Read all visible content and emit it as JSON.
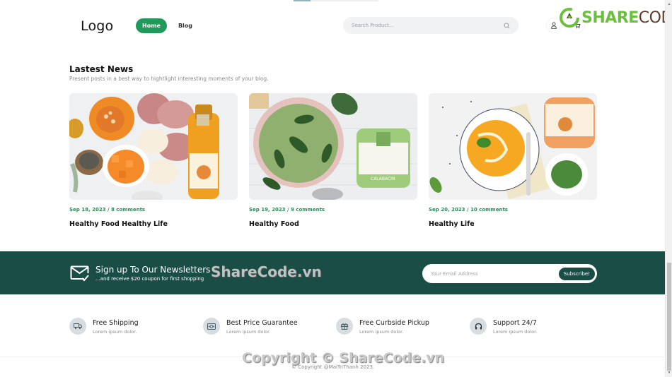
{
  "header": {
    "logo": "Logo",
    "nav": [
      {
        "label": "Home",
        "active": true
      },
      {
        "label": "Blog",
        "active": false
      }
    ],
    "search": {
      "placeholder": "Search Product...",
      "value": ""
    },
    "icons": [
      "user-icon",
      "cart-icon"
    ]
  },
  "watermark": {
    "brand_green": "SHARE",
    "brand_brown": "CODE.vn",
    "band_text": "ShareCode.vn",
    "footer_text": "Copyright © ShareCode.vn"
  },
  "news": {
    "title": "Lastest News",
    "subtitle": "Present posts in a best way to hightlight interesting moments of your blog.",
    "posts": [
      {
        "meta": "Sep 18, 2023 / 8 comments",
        "title": "Healthy Food Healthy Life",
        "image": "pumpkin-potatoes-juice-bottle"
      },
      {
        "meta": "Sep 19, 2023 / 9 comments",
        "title": "Healthy Food",
        "image": "green-soup-calabacin-jar"
      },
      {
        "meta": "Sep 20, 2023 / 10 comments",
        "title": "Healthy Life",
        "image": "pumpkin-soup-calabaza-jar"
      }
    ]
  },
  "newsletter": {
    "title": "Sign up To Our Newsletters",
    "subtitle": "...and receive $20 coupon for first shopping",
    "email_placeholder": "Your Email Address",
    "email_value": "",
    "button": "Subscribe!"
  },
  "features": [
    {
      "icon": "truck-icon",
      "title": "Free Shipping",
      "desc": "Lorem ipsum dolor."
    },
    {
      "icon": "money-icon",
      "title": "Best Price Guarantee",
      "desc": "Lorem ipsum dolor."
    },
    {
      "icon": "gift-icon",
      "title": "Free Curbside Pickup",
      "desc": "Lorem ipsum dolor."
    },
    {
      "icon": "headset-icon",
      "title": "Support 24/7",
      "desc": "Lorem ipsum dolor."
    }
  ],
  "footer": {
    "copyright": "© Copyright @MaiTriThanh 2023."
  },
  "colors": {
    "primary_green": "#1f9a5a",
    "dark_teal": "#1b4d47",
    "meta_green": "#2e8b57",
    "search_bg": "#f1f2f4",
    "feature_icon_bg": "#d8dde2"
  }
}
